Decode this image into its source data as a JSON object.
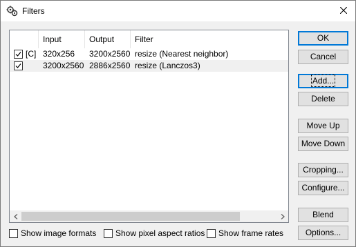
{
  "window": {
    "title": "Filters",
    "title_icon": "filter-gears-icon",
    "close_icon": "close-icon"
  },
  "list": {
    "columns": [
      "",
      "Input",
      "Output",
      "Filter"
    ],
    "rows": [
      {
        "checked": true,
        "flag": "[C]",
        "input": "320x256",
        "output": "3200x2560",
        "filter": "resize (Nearest neighbor)"
      },
      {
        "checked": true,
        "flag": "",
        "input": "3200x2560",
        "output": "2886x2560",
        "filter": "resize (Lanczos3)"
      }
    ]
  },
  "buttons": {
    "ok": "OK",
    "cancel": "Cancel",
    "add": "Add...",
    "delete": "Delete",
    "move_up": "Move Up",
    "move_down": "Move Down",
    "cropping": "Cropping...",
    "configure": "Configure...",
    "blend": "Blend",
    "options": "Options..."
  },
  "options": {
    "show_image_formats": "Show image formats",
    "show_pixel_aspect": "Show pixel aspect ratios",
    "show_frame_rates": "Show frame rates"
  },
  "colors": {
    "accent": "#0078d7",
    "button_face": "#e1e1e1",
    "dialog_bg": "#f0f0f0"
  }
}
